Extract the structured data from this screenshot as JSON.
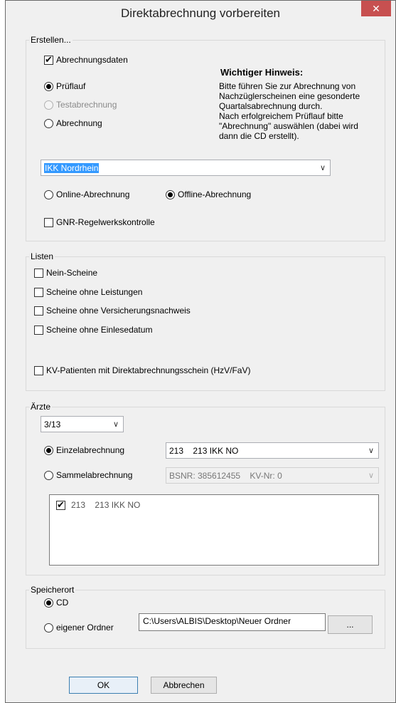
{
  "window": {
    "title": "Direktabrechnung vorbereiten",
    "close_glyph": "✕"
  },
  "erstellen": {
    "legend": "Erstellen...",
    "abrechnungsdaten": {
      "label": "Abrechnungsdaten",
      "checked": true
    },
    "mode_options": [
      {
        "label": "Prüflauf",
        "checked": true,
        "disabled": false
      },
      {
        "label": "Testabrechnung",
        "checked": false,
        "disabled": true
      },
      {
        "label": "Abrechnung",
        "checked": false,
        "disabled": false
      }
    ],
    "hint_title": "Wichtiger Hinweis:",
    "hint_lines": [
      "Bitte führen Sie zur Abrechnung von",
      "Nachzüglerscheinen eine gesonderte",
      "Quartalsabrechnung durch.",
      "Nach erfolgreichem Prüflauf bitte",
      "\"Abrechnung\" auswählen (dabei wird",
      "dann die CD erstellt)."
    ],
    "kasse_select": "IKK Nordrhein",
    "online": {
      "label": "Online-Abrechnung",
      "checked": false
    },
    "offline": {
      "label": "Offline-Abrechnung",
      "checked": true
    },
    "gnr": {
      "label": "GNR-Regelwerkskontrolle",
      "checked": false
    }
  },
  "listen": {
    "legend": "Listen",
    "items": [
      {
        "label": "Nein-Scheine",
        "checked": false
      },
      {
        "label": "Scheine ohne Leistungen",
        "checked": false
      },
      {
        "label": "Scheine ohne Versicherungsnachweis",
        "checked": false
      },
      {
        "label": "Scheine ohne Einlesedatum",
        "checked": false
      }
    ],
    "kv_patienten": {
      "label": "KV-Patienten mit Direktabrechnungsschein (HzV/FaV)",
      "checked": false
    }
  },
  "aerzte": {
    "legend": "Ärzte",
    "quarter": "3/13",
    "einzel": {
      "label": "Einzelabrechnung",
      "checked": true
    },
    "einzel_select": "213    213 IKK NO",
    "sammel": {
      "label": "Sammelabrechnung",
      "checked": false
    },
    "sammel_select": "BSNR: 385612455    KV-Nr: 0",
    "list_items": [
      {
        "label": "213    213 IKK NO",
        "checked": true
      }
    ]
  },
  "speicherort": {
    "legend": "Speicherort",
    "cd": {
      "label": "CD",
      "checked": true
    },
    "ordner": {
      "label": "eigener Ordner",
      "checked": false
    },
    "path": "C:\\Users\\ALBIS\\Desktop\\Neuer Ordner",
    "browse_label": "..."
  },
  "buttons": {
    "ok": "OK",
    "cancel": "Abbrechen"
  }
}
